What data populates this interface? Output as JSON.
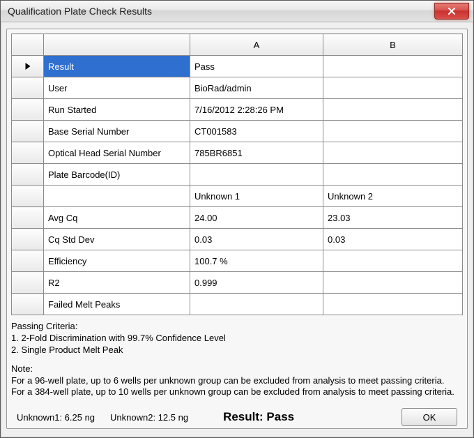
{
  "window": {
    "title": "Qualification Plate Check Results"
  },
  "grid": {
    "headers": {
      "rowhdr": "",
      "label": "",
      "a": "A",
      "b": "B"
    },
    "rows": [
      {
        "label": "Result",
        "a": "Pass",
        "b": ""
      },
      {
        "label": "User",
        "a": "BioRad/admin",
        "b": ""
      },
      {
        "label": "Run Started",
        "a": "7/16/2012 2:28:26 PM",
        "b": ""
      },
      {
        "label": "Base Serial Number",
        "a": "CT001583",
        "b": ""
      },
      {
        "label": "Optical Head Serial Number",
        "a": "785BR6851",
        "b": ""
      },
      {
        "label": "Plate Barcode(ID)",
        "a": "",
        "b": ""
      },
      {
        "label": "",
        "a": "Unknown 1",
        "b": "Unknown 2"
      },
      {
        "label": "Avg Cq",
        "a": "24.00",
        "b": "23.03"
      },
      {
        "label": "Cq Std Dev",
        "a": "0.03",
        "b": "0.03"
      },
      {
        "label": "Efficiency",
        "a": "100.7 %",
        "b": ""
      },
      {
        "label": "R2",
        "a": "0.999",
        "b": ""
      },
      {
        "label": "Failed Melt Peaks",
        "a": "",
        "b": ""
      }
    ]
  },
  "notes": {
    "criteria_heading": "Passing Criteria:",
    "criteria_1": "1. 2-Fold Discrimination with 99.7% Confidence Level",
    "criteria_2": "2. Single Product Melt Peak",
    "note_heading": "Note:",
    "note_1": "For a 96-well plate, up to 6 wells per unknown group can be excluded from analysis to meet passing criteria.",
    "note_2": "For a 384-well plate, up to 10 wells per unknown group can be excluded from analysis to meet passing criteria."
  },
  "footer": {
    "unknown1": "Unknown1: 6.25 ng",
    "unknown2": "Unknown2: 12.5 ng",
    "result": "Result: Pass",
    "ok": "OK"
  }
}
